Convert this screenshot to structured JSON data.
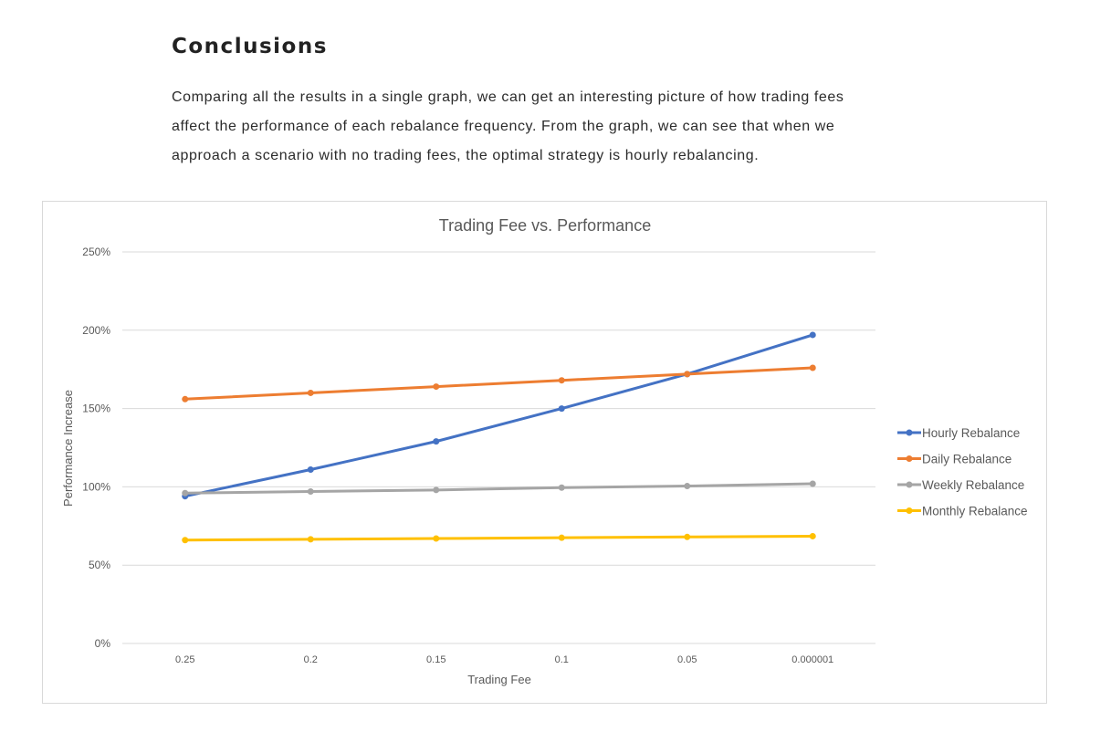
{
  "section": {
    "heading": "Conclusions",
    "paragraph_lines": [
      "Comparing all the results in a single graph, we can get an interesting picture of how trading fees",
      "affect the performance of each rebalance frequency.  From the graph, we can see that when we",
      "approach a scenario with no trading fees, the optimal strategy is hourly rebalancing."
    ]
  },
  "chart_data": {
    "type": "line",
    "title": "Trading Fee vs. Performance",
    "xlabel": "Trading Fee",
    "ylabel": "Performance Increase",
    "x": [
      "0.25",
      "0.2",
      "0.15",
      "0.1",
      "0.05",
      "0.000001"
    ],
    "ylim": [
      0,
      250
    ],
    "yticks": [
      "0%",
      "50%",
      "100%",
      "150%",
      "200%",
      "250%"
    ],
    "grid": true,
    "legend_position": "right",
    "series": [
      {
        "name": "Hourly Rebalance",
        "color": "#4472C4",
        "values": [
          94,
          111,
          129,
          150,
          172,
          197
        ]
      },
      {
        "name": "Daily Rebalance",
        "color": "#ED7D31",
        "values": [
          156,
          160,
          164,
          168,
          172,
          176
        ]
      },
      {
        "name": "Weekly Rebalance",
        "color": "#A5A5A5",
        "values": [
          96,
          97,
          98,
          99.5,
          100.5,
          102
        ]
      },
      {
        "name": "Monthly Rebalance",
        "color": "#FFC000",
        "values": [
          66,
          66.5,
          67,
          67.5,
          68,
          68.5
        ]
      }
    ]
  }
}
